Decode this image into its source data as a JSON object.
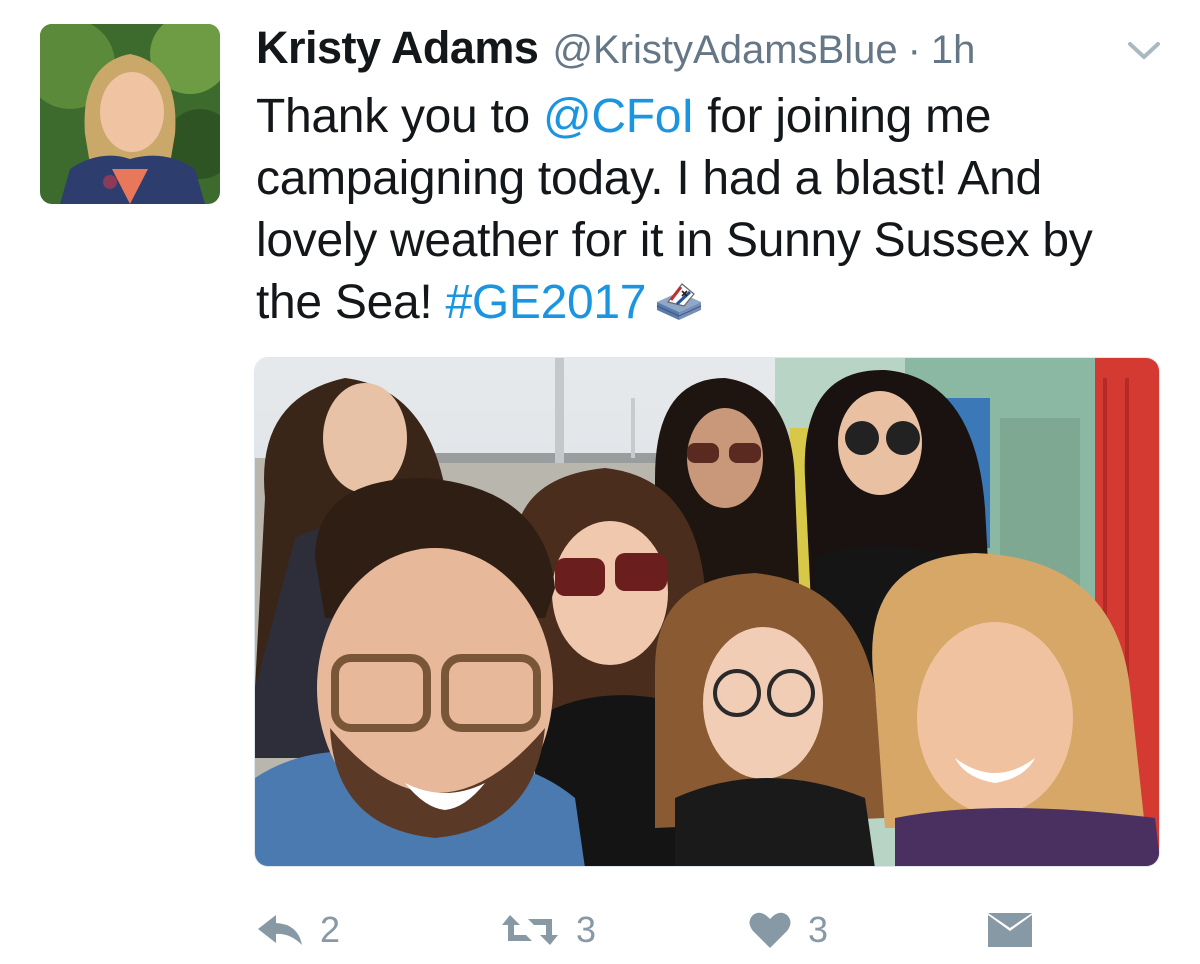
{
  "tweet": {
    "author_name": "Kristy Adams",
    "author_handle": "@KristyAdamsBlue",
    "separator": "·",
    "time": "1h",
    "text_parts": [
      "Thank you to ",
      "@CFoI",
      " for joining me campaigning today. I had a blast! And lovely weather for it in Sunny Sussex by the Sea! ",
      "#GE2017"
    ],
    "emoji": "ballot-box-icon"
  },
  "actions": {
    "reply_count": "2",
    "retweet_count": "3",
    "like_count": "3"
  },
  "colors": {
    "link": "#1b95e0",
    "secondary_text": "#657786",
    "action_gray": "#8899a6"
  }
}
